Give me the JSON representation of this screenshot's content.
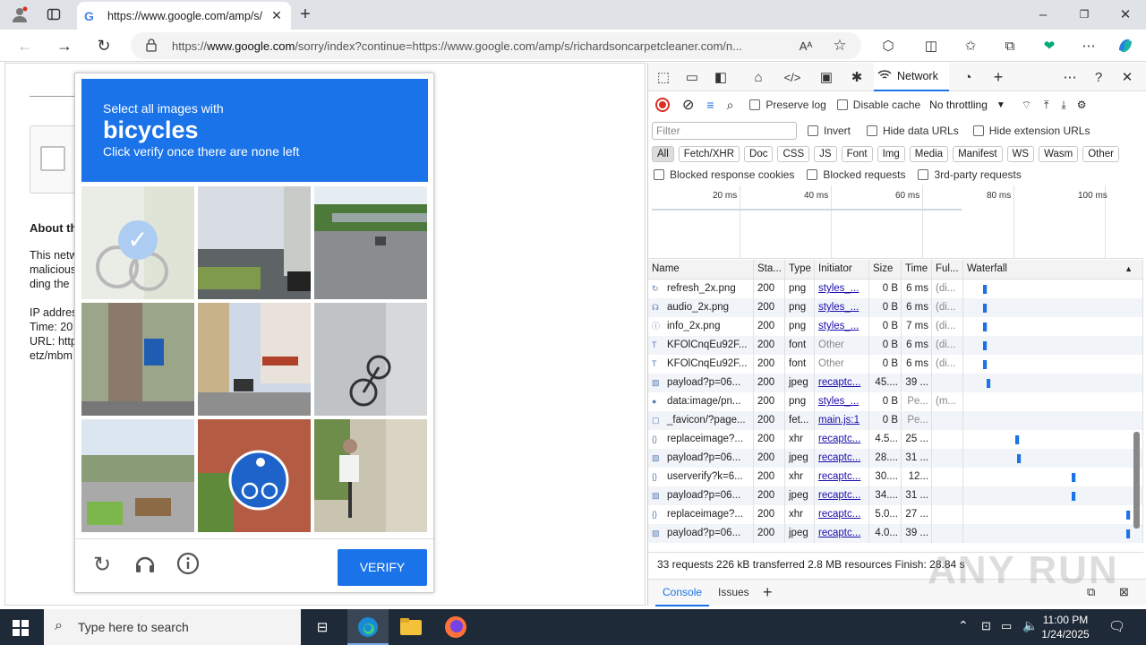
{
  "browser": {
    "tab_title": "https://www.google.com/amp/s/",
    "url_prefix": "https://",
    "url_host": "www.google.com",
    "url_rest": "/sorry/index?continue=https://www.google.com/amp/s/richardsoncarpetcleaner.com/n...",
    "reader_label": "Aᴬ"
  },
  "page": {
    "about_heading": "About th",
    "lines_a": [
      "This netw",
      "malicious",
      "ding the"
    ],
    "lines_b": [
      "IP addres",
      "Time: 20",
      "URL: http",
      "etz/mbm"
    ]
  },
  "captcha": {
    "line1": "Select all images with",
    "keyword": "bicycles",
    "line3": "Click verify once there are none left",
    "verify_label": "VERIFY",
    "selected_tile": 1
  },
  "devtools": {
    "active_panel": "Network",
    "preserve_log": "Preserve log",
    "disable_cache": "Disable cache",
    "throttling": "No throttling",
    "filter_placeholder": "Filter",
    "invert": "Invert",
    "hide_data_urls": "Hide data URLs",
    "hide_ext_urls": "Hide extension URLs",
    "chips": [
      "All",
      "Fetch/XHR",
      "Doc",
      "CSS",
      "JS",
      "Font",
      "Img",
      "Media",
      "Manifest",
      "WS",
      "Wasm",
      "Other"
    ],
    "blocked_cookies": "Blocked response cookies",
    "blocked_requests": "Blocked requests",
    "third_party": "3rd-party requests",
    "timeline_labels": [
      "20 ms",
      "40 ms",
      "60 ms",
      "80 ms",
      "100 ms"
    ],
    "columns": [
      "Name",
      "Sta...",
      "Type",
      "Initiator",
      "Size",
      "Time",
      "Ful...",
      "Waterfall"
    ],
    "rows": [
      {
        "icon": "↻",
        "name": "refresh_2x.png",
        "status": "200",
        "type": "png",
        "initiator": "styles_...",
        "init_link": true,
        "size": "0 B",
        "time": "6 ms",
        "full": "(di...",
        "wf": 0.1
      },
      {
        "icon": "☊",
        "name": "audio_2x.png",
        "status": "200",
        "type": "png",
        "initiator": "styles_...",
        "init_link": true,
        "size": "0 B",
        "time": "6 ms",
        "full": "(di...",
        "wf": 0.1
      },
      {
        "icon": "ⓘ",
        "name": "info_2x.png",
        "status": "200",
        "type": "png",
        "initiator": "styles_...",
        "init_link": true,
        "size": "0 B",
        "time": "7 ms",
        "full": "(di...",
        "wf": 0.1
      },
      {
        "icon": "T",
        "name": "KFOlCnqEu92F...",
        "status": "200",
        "type": "font",
        "initiator": "Other",
        "init_link": false,
        "size": "0 B",
        "time": "6 ms",
        "full": "(di...",
        "wf": 0.1
      },
      {
        "icon": "T",
        "name": "KFOlCnqEu92F...",
        "status": "200",
        "type": "font",
        "initiator": "Other",
        "init_link": false,
        "size": "0 B",
        "time": "6 ms",
        "full": "(di...",
        "wf": 0.1
      },
      {
        "icon": "▧",
        "name": "payload?p=06...",
        "status": "200",
        "type": "jpeg",
        "initiator": "recaptc...",
        "init_link": true,
        "size": "45....",
        "time": "39 ...",
        "full": "",
        "wf": 0.12
      },
      {
        "icon": "●",
        "name": "data:image/pn...",
        "status": "200",
        "type": "png",
        "initiator": "styles_...",
        "init_link": true,
        "size": "0 B",
        "time": "Pe...",
        "full": "(m...",
        "wf": null
      },
      {
        "icon": "▢",
        "name": "_favicon/?page...",
        "status": "200",
        "type": "fet...",
        "initiator": "main.js:1",
        "init_link": true,
        "size": "0 B",
        "time": "Pe...",
        "full": "",
        "wf": null
      },
      {
        "icon": "{}",
        "name": "replaceimage?...",
        "status": "200",
        "type": "xhr",
        "initiator": "recaptc...",
        "init_link": true,
        "size": "4.5...",
        "time": "25 ...",
        "full": "",
        "wf": 0.3
      },
      {
        "icon": "▧",
        "name": "payload?p=06...",
        "status": "200",
        "type": "jpeg",
        "initiator": "recaptc...",
        "init_link": true,
        "size": "28....",
        "time": "31 ...",
        "full": "",
        "wf": 0.31
      },
      {
        "icon": "{}",
        "name": "userverify?k=6...",
        "status": "200",
        "type": "xhr",
        "initiator": "recaptc...",
        "init_link": true,
        "size": "30....",
        "time": "12...",
        "full": "",
        "wf": 0.65
      },
      {
        "icon": "▧",
        "name": "payload?p=06...",
        "status": "200",
        "type": "jpeg",
        "initiator": "recaptc...",
        "init_link": true,
        "size": "34....",
        "time": "31 ...",
        "full": "",
        "wf": 0.65
      },
      {
        "icon": "{}",
        "name": "replaceimage?...",
        "status": "200",
        "type": "xhr",
        "initiator": "recaptc...",
        "init_link": true,
        "size": "5.0...",
        "time": "27 ...",
        "full": "",
        "wf": 0.99
      },
      {
        "icon": "▧",
        "name": "payload?p=06...",
        "status": "200",
        "type": "jpeg",
        "initiator": "recaptc...",
        "init_link": true,
        "size": "4.0...",
        "time": "39 ...",
        "full": "",
        "wf": 0.99
      }
    ],
    "summary": "33 requests  226 kB transferred  2.8 MB resources  Finish: 28.84 s",
    "drawer_tabs": [
      "Console",
      "Issues"
    ]
  },
  "taskbar": {
    "search_placeholder": "Type here to search",
    "time": "11:00 PM",
    "date": "1/24/2025"
  },
  "watermark": "ANY RUN",
  "colors": {
    "accent": "#1a73e8",
    "taskbar": "#1f2a38"
  }
}
